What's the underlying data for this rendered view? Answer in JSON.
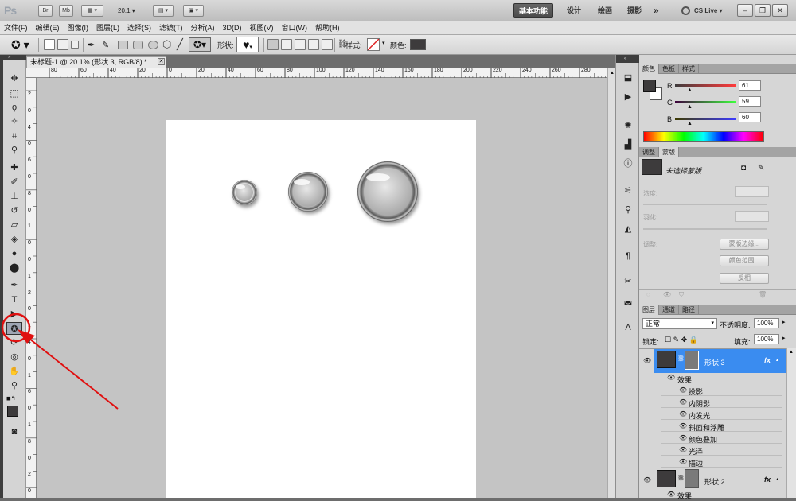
{
  "titlebar": {
    "logo": "Ps",
    "zoom": "20.1",
    "workspaces": [
      "基本功能",
      "设计",
      "绘画",
      "摄影"
    ],
    "more": "»",
    "cslive": "CS Live"
  },
  "menubar": [
    "文件(F)",
    "编辑(E)",
    "图像(I)",
    "图层(L)",
    "选择(S)",
    "滤镜(T)",
    "分析(A)",
    "3D(D)",
    "视图(V)",
    "窗口(W)",
    "帮助(H)"
  ],
  "options": {
    "shape_label": "形状:",
    "style_label": "样式:",
    "color_label": "颜色:",
    "color": "#3d3b3c"
  },
  "document": {
    "tab_title": "未标题-1 @ 20.1% (形状 3, RGB/8) *",
    "ruler_top": [
      "80",
      "60",
      "40",
      "20",
      "0",
      "20",
      "40",
      "60",
      "80",
      "100",
      "120",
      "140",
      "160",
      "180",
      "200",
      "220",
      "240",
      "260",
      "280"
    ],
    "ruler_left": [
      "2",
      "0",
      "4",
      "0",
      "6",
      "0",
      "8",
      "0",
      "1",
      "0",
      "0",
      "1",
      "2",
      "0",
      "1",
      "4",
      "0",
      "1",
      "6",
      "0",
      "1",
      "8",
      "0",
      "2",
      "0"
    ]
  },
  "color_panel": {
    "tabs": [
      "颜色",
      "色板",
      "样式"
    ],
    "r_label": "R",
    "g_label": "G",
    "b_label": "B",
    "r": "61",
    "g": "59",
    "b": "60",
    "foreground": "#3d3b3c"
  },
  "masks_panel": {
    "tabs": [
      "调整",
      "蒙版"
    ],
    "no_mask": "未选择蒙版",
    "density": "浓度:",
    "feather": "羽化:",
    "refine": "调整:",
    "btn_edge": "蒙版边缘...",
    "btn_range": "颜色范围...",
    "btn_invert": "反相"
  },
  "layers_panel": {
    "tabs": [
      "图层",
      "通道",
      "路径"
    ],
    "blend_mode": "正常",
    "opacity_label": "不透明度:",
    "opacity": "100%",
    "lock_label": "锁定:",
    "fill_label": "填充:",
    "fill": "100%",
    "layer3": "形状 3",
    "effects_label": "效果",
    "effects": [
      "投影",
      "内阴影",
      "内发光",
      "斜面和浮雕",
      "颜色叠加",
      "光泽",
      "描边"
    ],
    "layer2": "形状 2",
    "layer2_effects": "效果",
    "fx": "fx"
  }
}
